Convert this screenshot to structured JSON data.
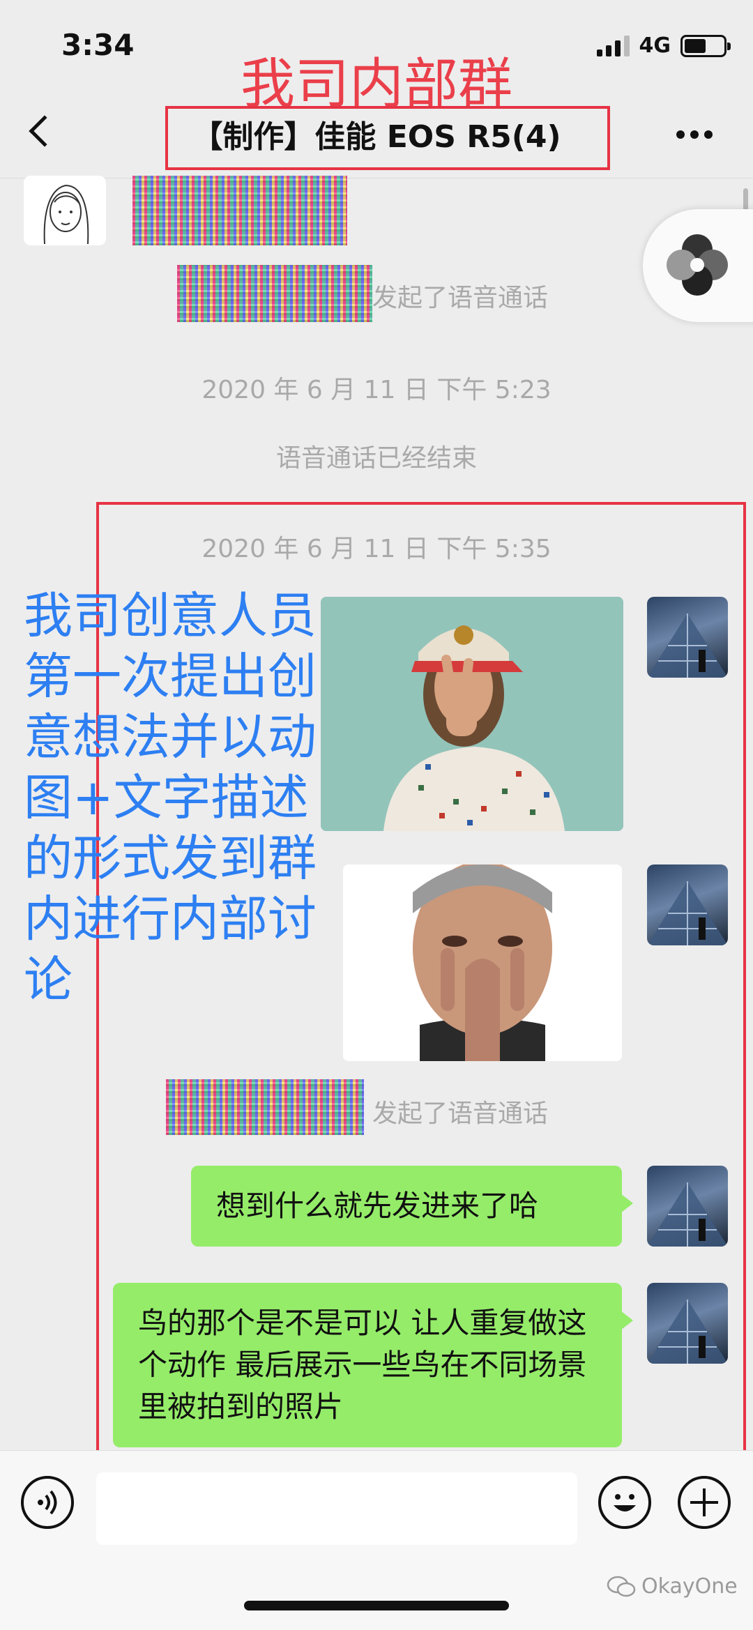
{
  "status_bar": {
    "time": "3:34",
    "network": "4G",
    "signal_bars_on": 3,
    "battery_level": 0.55
  },
  "overlay": {
    "header_caption": "我司内部群",
    "annotation": "我司创意人员第一次提出创意想法并以动图+文字描述的形式发到群内进行内部讨论"
  },
  "nav": {
    "title": "【制作】佳能 EOS R5(4)",
    "back_icon": "chevron-left-icon",
    "more_icon": "more-dots-icon"
  },
  "messages": {
    "call_started_1": "发起了语音通话",
    "timestamp_1": "2020 年 6 月 11 日 下午 5:23",
    "call_ended": "语音通话已经结束",
    "timestamp_2": "2020 年 6 月 11 日 下午 5:35",
    "call_started_2": "发起了语音通话",
    "text_1": "想到什么就先发进来了哈",
    "text_2": "鸟的那个是不是可以 让人重复做这个动作 最后展示一些鸟在不同场景里被拍到的照片"
  },
  "input_bar": {
    "voice_icon": "voice-icon",
    "emoji_icon": "emoji-icon",
    "plus_icon": "plus-icon"
  },
  "watermark": "OkayOne",
  "colors": {
    "accent_red": "#e63344",
    "annotation_blue": "#2d7ff2",
    "bubble_green": "#95ec69",
    "background": "#ededed"
  }
}
